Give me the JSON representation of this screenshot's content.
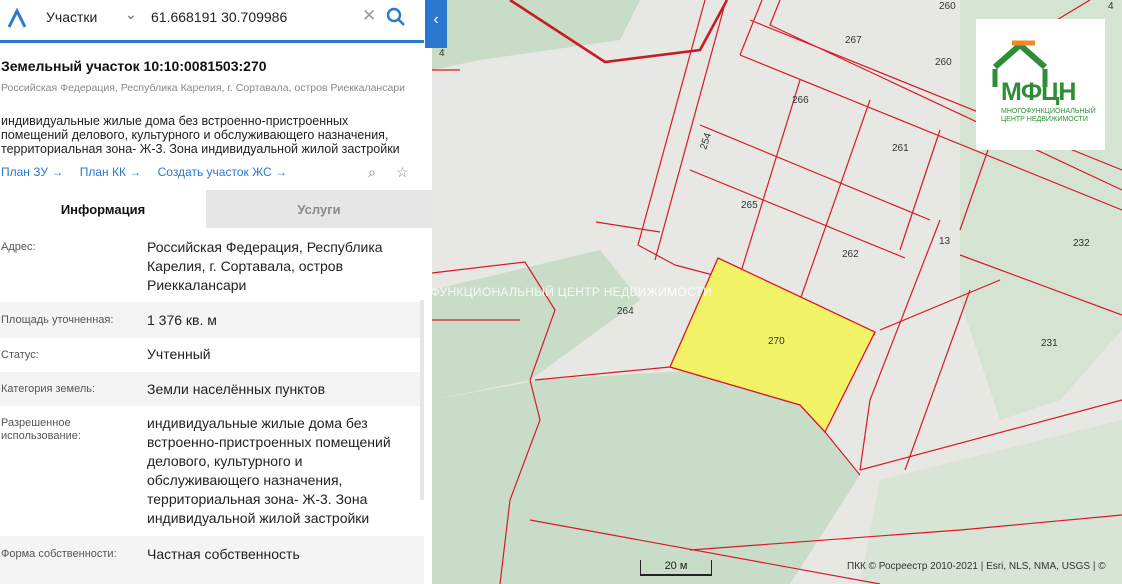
{
  "search": {
    "category": "Участки",
    "query": "61.668191 30.709986"
  },
  "parcel": {
    "title": "Земельный участок 10:10:0081503:270",
    "address_short": "Российская Федерация, Республика Карелия, г. Сортавала, остров Риеккалансари",
    "usage_description": "индивидуальные жилые дома без встроенно-пристроенных помещений делового, культурного и обслуживающего назначения, территориальная зона- Ж-3. Зона индивидуальной жилой застройки"
  },
  "links": {
    "plan_zu": "План ЗУ →",
    "plan_kk": "План КК →",
    "create_zhs": "Создать участок ЖС →"
  },
  "tabs": {
    "info": "Информация",
    "services": "Услуги"
  },
  "info_rows": [
    {
      "label": "Адрес:",
      "value": "Российская Федерация, Республика Карелия, г. Сортавала, остров Риеккалансари"
    },
    {
      "label": "Площадь уточненная:",
      "value": "1 376 кв. м"
    },
    {
      "label": "Статус:",
      "value": "Учтенный"
    },
    {
      "label": "Категория земель:",
      "value": "Земли населённых пунктов"
    },
    {
      "label": "Разрешенное использование:",
      "value": "индивидуальные жилые дома без встроенно-пристроенных помещений делового, культурного и обслуживающего назначения, территориальная зона- Ж-3. Зона индивидуальной жилой застройки"
    },
    {
      "label": "Форма собственности:",
      "value": "Частная собственность"
    }
  ],
  "map": {
    "parcel_labels": {
      "l260a": "260",
      "l260b": "260",
      "l267": "267",
      "l266": "266",
      "l254": "254",
      "l261": "261",
      "l265": "265",
      "l13": "13",
      "l232": "232",
      "l262": "262",
      "l264": "264",
      "l270": "270",
      "l231": "231",
      "l4": "4",
      "l4b": "4"
    },
    "selected_color": "#f2f266",
    "boundary_color": "#d9192a",
    "scale": "20 м",
    "attribution": "ПКК © Росреестр 2010-2021 | Esri, NLS, NMA, USGS | ©",
    "watermark": "МНОГОФУНКЦИОНАЛЬНЫЙ ЦЕНТР НЕДВИЖИМОСТИ"
  },
  "logo": {
    "name": "МФЦН",
    "subtitle": "МНОГОФУНКЦИОНАЛЬНЫЙ ЦЕНТР НЕДВИЖИМОСТИ"
  }
}
